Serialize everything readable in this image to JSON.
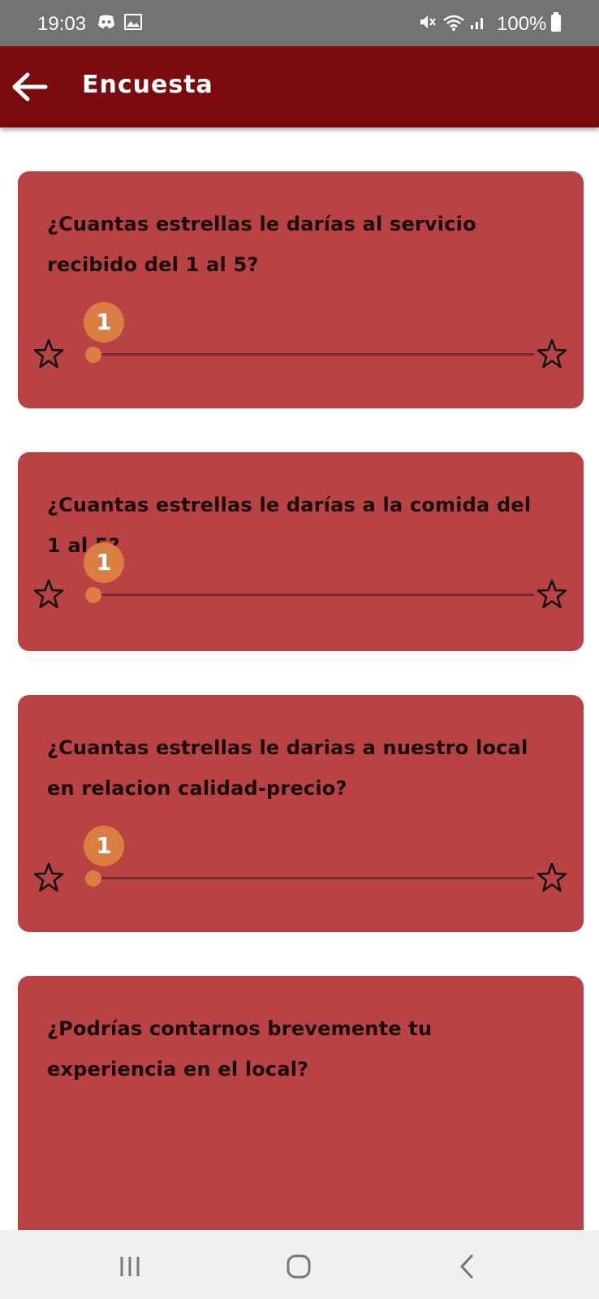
{
  "status_bar": {
    "time": "19:03",
    "battery": "100%",
    "icons": [
      "discord-icon",
      "image-icon",
      "mute-icon",
      "wifi-icon",
      "signal-icon",
      "battery-icon"
    ]
  },
  "app_bar": {
    "title": "Encuesta",
    "back_icon": "arrow-left-icon",
    "color": "#7a0a0e"
  },
  "colors": {
    "card": "#b84244",
    "accent": "#d97d40"
  },
  "questions": [
    {
      "text": "¿Cuantas estrellas le darías al servicio recibido del 1 al 5?",
      "type": "slider",
      "value": "1",
      "min": 1,
      "max": 5
    },
    {
      "text": "¿Cuantas estrellas le darías a la comida del 1 al 5?",
      "type": "slider",
      "value": "1",
      "min": 1,
      "max": 5
    },
    {
      "text": "¿Cuantas estrellas le darias a nuestro local en relacion calidad-precio?",
      "type": "slider",
      "value": "1",
      "min": 1,
      "max": 5
    },
    {
      "text": "¿Podrías contarnos brevemente tu experiencia en el local?",
      "type": "text",
      "value": ""
    }
  ],
  "nav_bar": {
    "icons": [
      "recent-apps-icon",
      "home-icon",
      "back-icon"
    ]
  }
}
